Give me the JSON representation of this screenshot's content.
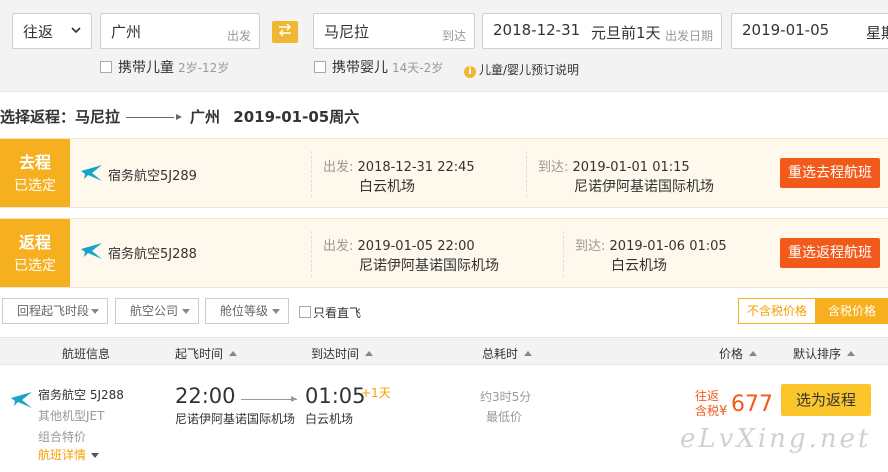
{
  "search": {
    "trip_type": "往返",
    "from_city": "广州",
    "from_hint": "出发",
    "to_city": "马尼拉",
    "to_hint": "到达",
    "depart_date": "2018-12-31",
    "depart_note": "元旦前1天",
    "depart_hint": "出发日期",
    "return_date": "2019-01-05",
    "return_hint": "星期"
  },
  "options": {
    "child_label": "携带儿童",
    "child_age": "2岁-12岁",
    "infant_label": "携带婴儿",
    "infant_age": "14天-2岁",
    "info_text": "儿童/婴儿预订说明"
  },
  "route_title": {
    "prefix": "选择返程：马尼拉",
    "dest": "广州",
    "date": "2019-01-05周六"
  },
  "selected": [
    {
      "tag_top": "去程",
      "tag_bottom": "已选定",
      "airline": "宿务航空5J289",
      "depart_label": "出发:",
      "depart_time": "2018-12-31 22:45",
      "depart_airport": "白云机场",
      "arrive_label": "到达:",
      "arrive_time": "2019-01-01 01:15",
      "arrive_airport": "尼诺伊阿基诺国际机场",
      "button": "重选去程航班"
    },
    {
      "tag_top": "返程",
      "tag_bottom": "已选定",
      "airline": "宿务航空5J288",
      "depart_label": "出发:",
      "depart_time": "2019-01-05 22:00",
      "depart_airport": "尼诺伊阿基诺国际机场",
      "arrive_label": "到达:",
      "arrive_time": "2019-01-06 01:05",
      "arrive_airport": "白云机场",
      "button": "重选返程航班"
    }
  ],
  "filters": {
    "f1": "回程起飞时段",
    "f2": "航空公司",
    "f3": "舱位等级",
    "direct": "只看直飞",
    "price_excl": "不含税价格",
    "price_incl": "含税价格"
  },
  "table_head": {
    "flight_info": "航班信息",
    "depart_time": "起飞时间",
    "arrive_time": "到达时间",
    "duration": "总耗时",
    "price": "价格",
    "sort": "默认排序"
  },
  "flight": {
    "airline": "宿务航空 5J288",
    "model": "其他机型JET",
    "fare_type": "组合特价",
    "detail": "航班详情",
    "depart_time": "22:00",
    "depart_airport": "尼诺伊阿基诺国际机场",
    "arrive_time": "01:05",
    "plus_day": "+1天",
    "arrive_airport": "白云机场",
    "duration": "约3时5分",
    "lowest": "最低价",
    "price_label_1": "往返",
    "price_label_2": "含税",
    "currency": "¥",
    "price": "677",
    "button": "选为返程"
  },
  "watermark": "eLvXing.net",
  "colors": {
    "accent": "#f6b01f",
    "button_orange": "#f25a1c",
    "button_yellow": "#fbc62b",
    "airline_logo": "#1aa3c8"
  }
}
